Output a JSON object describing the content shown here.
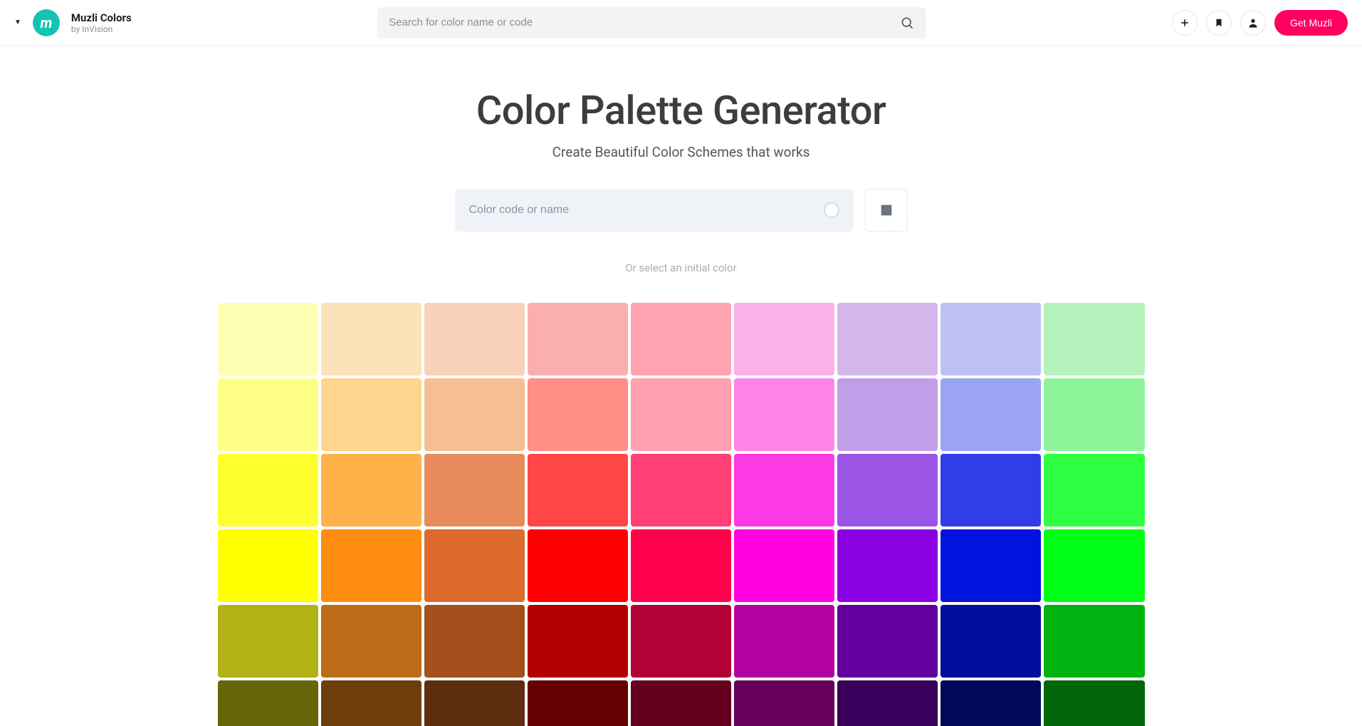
{
  "header": {
    "brand_title": "Muzli Colors",
    "brand_sub": "by InVision",
    "search_placeholder": "Search for color name or code",
    "cta_label": "Get Muzli"
  },
  "main": {
    "title": "Color Palette Generator",
    "subtitle": "Create Beautiful Color Schemes that works",
    "color_input_placeholder": "Color code or name",
    "hint": "Or select an initial color"
  },
  "grid": {
    "rows": [
      [
        "#ffffb3",
        "#fce2b8",
        "#f7d1b8",
        "#fbaeae",
        "#ffa3b0",
        "#fab1e7",
        "#d3b7ec",
        "#bcc0f5",
        "#b5f2bb"
      ],
      [
        "#ffff87",
        "#ffd48c",
        "#f6be93",
        "#ff8f87",
        "#ffa1b2",
        "#ff83e8",
        "#c19ee8",
        "#9ba4f3",
        "#8ef49a"
      ],
      [
        "#feff2f",
        "#ffb24a",
        "#e88a59",
        "#ff4747",
        "#ff3f75",
        "#ff38e6",
        "#9b55e6",
        "#2f3ee6",
        "#2fff42"
      ],
      [
        "#ffff00",
        "#ff8d12",
        "#dc6a2d",
        "#ff0000",
        "#ff004c",
        "#ff00e0",
        "#8a00e0",
        "#0013e0",
        "#00ff17"
      ],
      [
        "#b2b217",
        "#bd6c17",
        "#a44f1d",
        "#b30000",
        "#b30036",
        "#b3009e",
        "#62009e",
        "#000e9e",
        "#00b310"
      ],
      [
        "#666609",
        "#6d3e0a",
        "#5e2d10",
        "#660000",
        "#66001f",
        "#66005a",
        "#38005a",
        "#00085a",
        "#006609"
      ]
    ]
  }
}
